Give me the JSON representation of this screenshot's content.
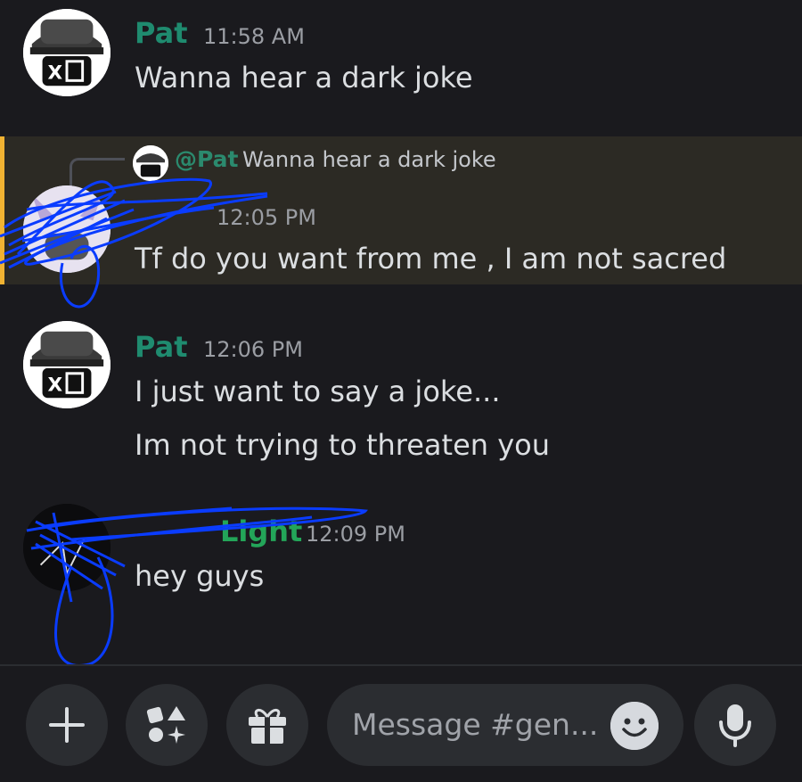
{
  "messages": [
    {
      "author": "Pat",
      "timestamp": "11:58 AM",
      "lines": [
        "Wanna hear a dark joke"
      ],
      "author_color": "#1f8b6f"
    },
    {
      "author": "",
      "timestamp": "12:05 PM",
      "lines": [
        "Tf do you want from me , I am not sacred"
      ],
      "reply": {
        "mention": "@Pat",
        "preview": "Wanna hear a dark joke"
      }
    },
    {
      "author": "Pat",
      "timestamp": "12:06 PM",
      "lines": [
        "I just want to say a joke...",
        "Im not trying to threaten you"
      ],
      "author_color": "#1f8b6f"
    },
    {
      "author": "Light",
      "timestamp": "12:09 PM",
      "lines": [
        "hey guys"
      ],
      "author_color": "#23a559"
    }
  ],
  "composer": {
    "placeholder": "Message #gen...",
    "buttons": [
      "plus-icon",
      "apps-icon",
      "gift-icon",
      "emoji-icon",
      "microphone-icon"
    ]
  },
  "colors": {
    "background": "#1a1a1e",
    "reply_highlight": "#2c2a24",
    "reply_accent": "#f0b232",
    "scribble": "#0a3cff"
  }
}
